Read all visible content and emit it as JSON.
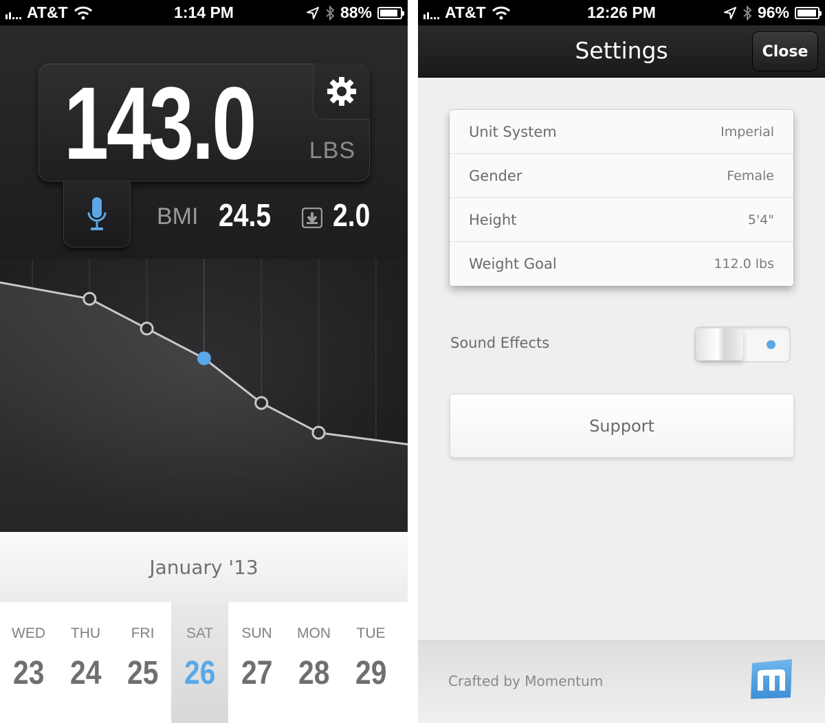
{
  "left": {
    "status": {
      "carrier": "AT&T",
      "time": "1:14 PM",
      "battery": "88%"
    },
    "weight": {
      "value": "143.0",
      "unit": "LBS"
    },
    "bmi": {
      "label": "BMI",
      "value": "24.5"
    },
    "change": {
      "value": "2.0",
      "icon": "down-arrow-icon"
    },
    "month": "January '13",
    "days": [
      {
        "dow": "WED",
        "num": "23"
      },
      {
        "dow": "THU",
        "num": "24"
      },
      {
        "dow": "FRI",
        "num": "25"
      },
      {
        "dow": "SAT",
        "num": "26",
        "selected": true
      },
      {
        "dow": "SUN",
        "num": "27"
      },
      {
        "dow": "MON",
        "num": "28"
      },
      {
        "dow": "TUE",
        "num": "29"
      }
    ],
    "icons": {
      "settings": "gear-icon",
      "voice": "microphone-icon"
    }
  },
  "right": {
    "status": {
      "carrier": "AT&T",
      "time": "12:26 PM",
      "battery": "96%"
    },
    "title": "Settings",
    "close_label": "Close",
    "rows": [
      {
        "label": "Unit System",
        "value": "Imperial"
      },
      {
        "label": "Gender",
        "value": "Female"
      },
      {
        "label": "Height",
        "value": "5'4\""
      },
      {
        "label": "Weight Goal",
        "value": "112.0 lbs"
      }
    ],
    "sound_effects": {
      "label": "Sound Effects",
      "enabled": false
    },
    "support_label": "Support",
    "credit": "Crafted by Momentum",
    "logo": "momentum-logo-icon"
  },
  "chart_data": {
    "type": "line",
    "x": [
      "WED",
      "THU",
      "FRI",
      "SAT",
      "SUN",
      "MON",
      "TUE"
    ],
    "series": [
      {
        "values": [
          null,
          144.2,
          143.6,
          143.0,
          142.1,
          141.5,
          null
        ],
        "selected_index": 3
      }
    ],
    "colors": {
      "point": "#ffffff",
      "selected": "#5aa8e6",
      "line": "#c8c8c8"
    }
  }
}
